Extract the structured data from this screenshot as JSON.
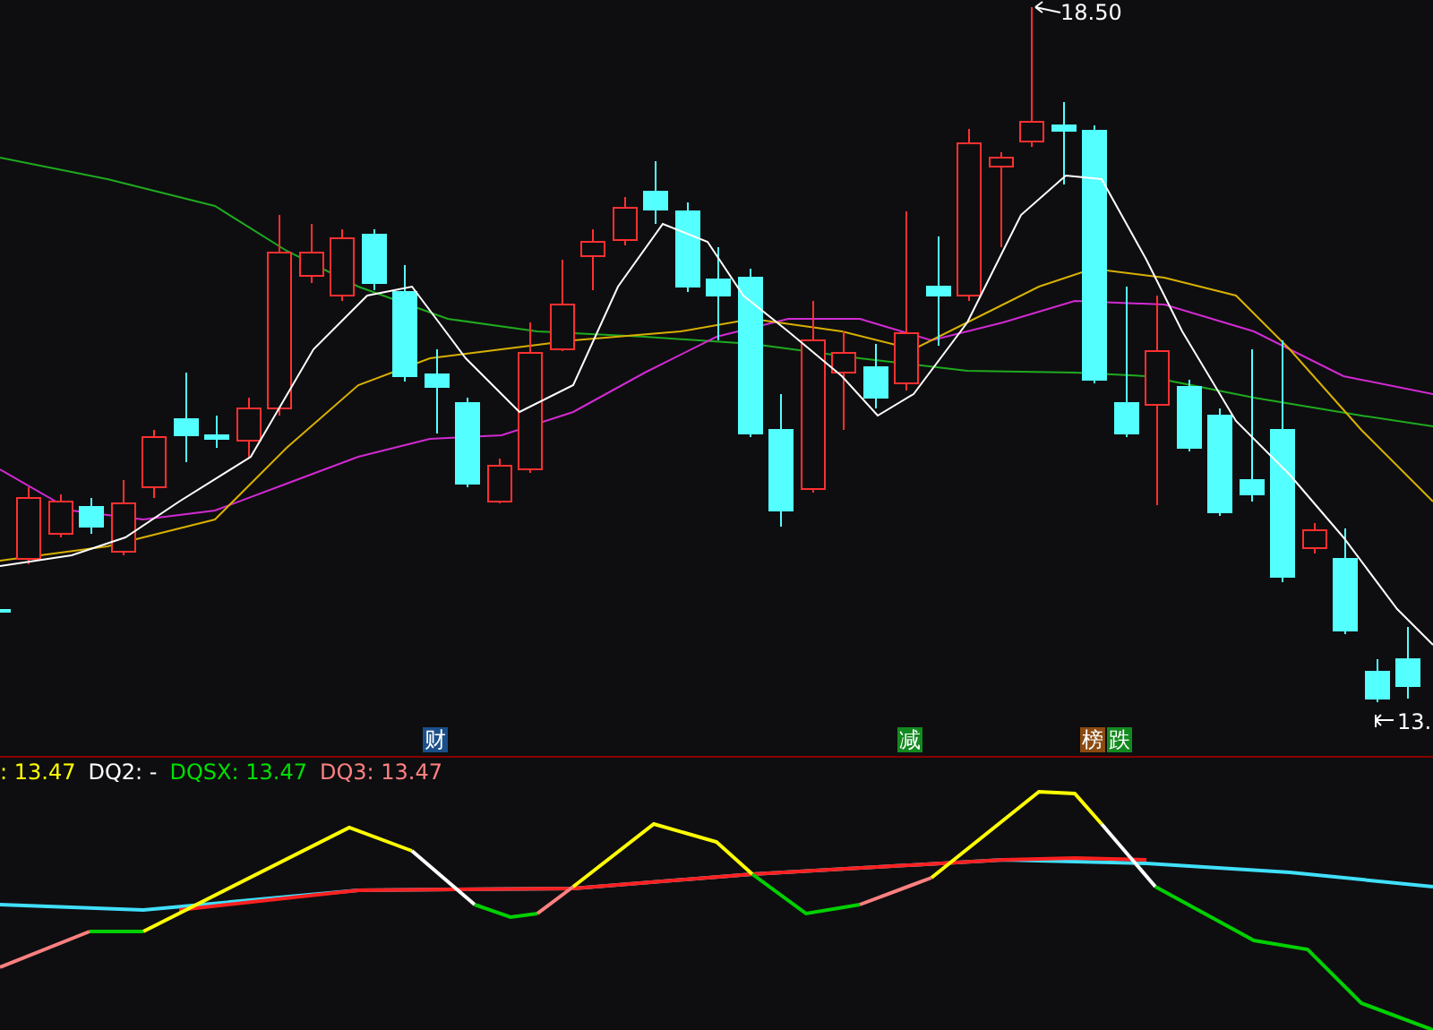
{
  "price_chart": {
    "high_label": "18.50",
    "low_label": "13.",
    "markers": [
      {
        "text": "财",
        "color": "#1a4f8a"
      },
      {
        "text": "减",
        "color": "#138a1f"
      },
      {
        "text": "榜",
        "color": "#8a4a10"
      },
      {
        "text": "跌",
        "color": "#138a1f"
      }
    ]
  },
  "indicator_panel": {
    "legend": [
      {
        "text": ": 13.47",
        "color": "#ffff00"
      },
      {
        "text": "DQ2: -",
        "color": "#ffffff"
      },
      {
        "text": "DQSX: 13.47",
        "color": "#00e000"
      },
      {
        "text": "DQ3: 13.47",
        "color": "#ff8080"
      }
    ]
  }
}
